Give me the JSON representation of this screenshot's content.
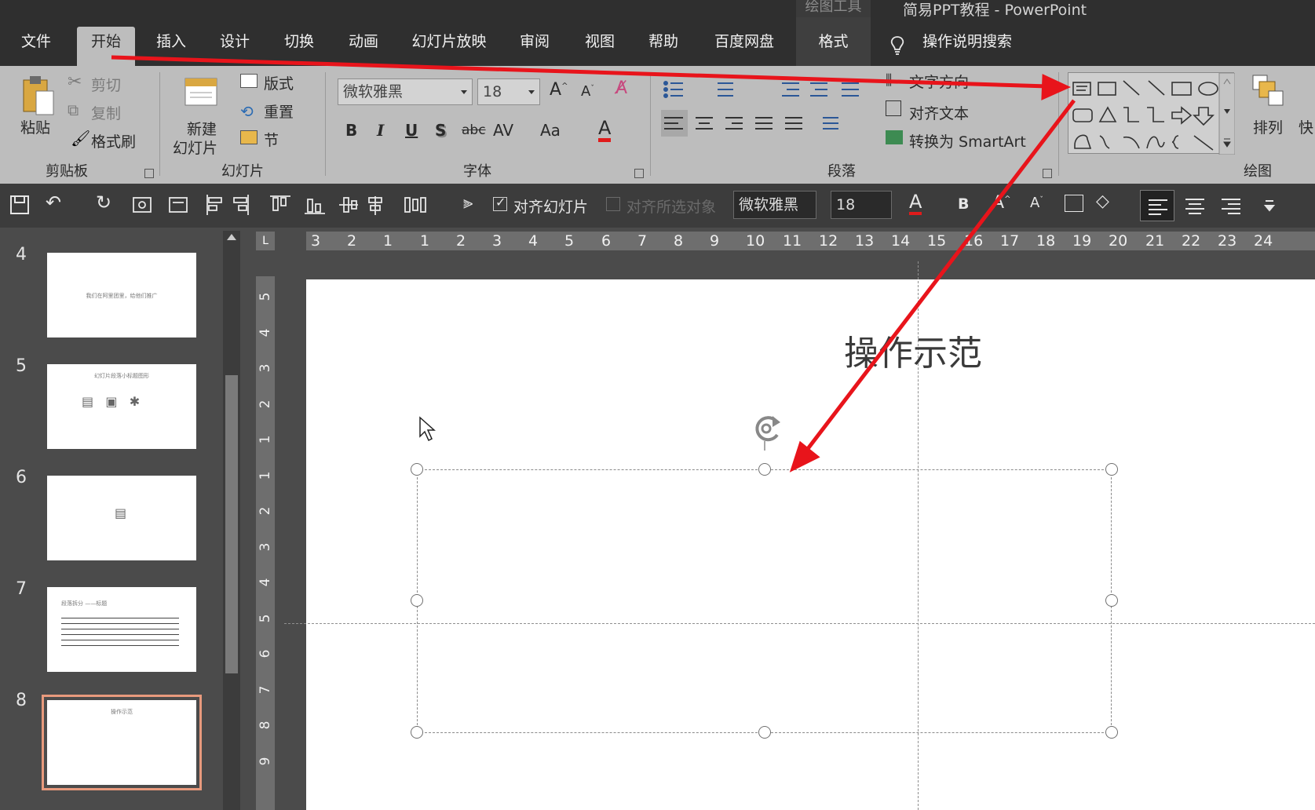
{
  "title_bar": {
    "contextual_tools": "绘图工具",
    "window_title": "简易PPT教程  -  PowerPoint"
  },
  "tabs": [
    "文件",
    "开始",
    "插入",
    "设计",
    "切换",
    "动画",
    "幻灯片放映",
    "审阅",
    "视图",
    "帮助",
    "百度网盘",
    "格式"
  ],
  "active_tab": "开始",
  "tell_me": "操作说明搜索",
  "ribbon": {
    "clipboard": {
      "paste": "粘贴",
      "cut": "剪切",
      "copy": "复制",
      "format_painter": "格式刷",
      "group": "剪贴板"
    },
    "slides": {
      "new_slide_line1": "新建",
      "new_slide_line2": "幻灯片",
      "layout": "版式",
      "reset": "重置",
      "section": "节",
      "group": "幻灯片"
    },
    "font": {
      "font_name": "微软雅黑",
      "font_size": "18",
      "bold": "B",
      "italic": "I",
      "underline": "U",
      "shadow": "S",
      "strike": "abc",
      "spacing": "AV",
      "case": "Aa",
      "color": "A",
      "group": "字体"
    },
    "paragraph": {
      "text_direction": "文字方向",
      "align_text": "对齐文本",
      "smartart": "转换为 SmartArt",
      "group": "段落"
    },
    "drawing": {
      "arrange": "排列",
      "quick_styles": "快",
      "group": "绘图"
    }
  },
  "qat": {
    "align_slide": "对齐幻灯片",
    "align_selected": "对齐所选对象",
    "font_name": "微软雅黑",
    "font_size": "18",
    "bold": "B"
  },
  "slides": [
    {
      "num": "4",
      "text": "我们在阿里团里，给他们推广"
    },
    {
      "num": "5",
      "text": "幻灯片段落小标题图形"
    },
    {
      "num": "6",
      "text": ""
    },
    {
      "num": "7",
      "text": "段落拆分 ——标题"
    },
    {
      "num": "8",
      "text": "操作示范"
    }
  ],
  "ruler_h": [
    "3",
    "2",
    "1",
    "1",
    "2",
    "3",
    "4",
    "5",
    "6",
    "7",
    "8",
    "9",
    "10",
    "11",
    "12",
    "13",
    "14",
    "15",
    "16",
    "17",
    "18",
    "19",
    "20",
    "21",
    "22",
    "23",
    "24"
  ],
  "ruler_v": [
    "5",
    "4",
    "3",
    "2",
    "1",
    "1",
    "2",
    "3",
    "4",
    "5",
    "6",
    "7",
    "8",
    "9"
  ],
  "slide_title": "操作示范",
  "colors": {
    "annotation_arrow": "#e8141b",
    "selected_thumb": "#e89a7d"
  }
}
